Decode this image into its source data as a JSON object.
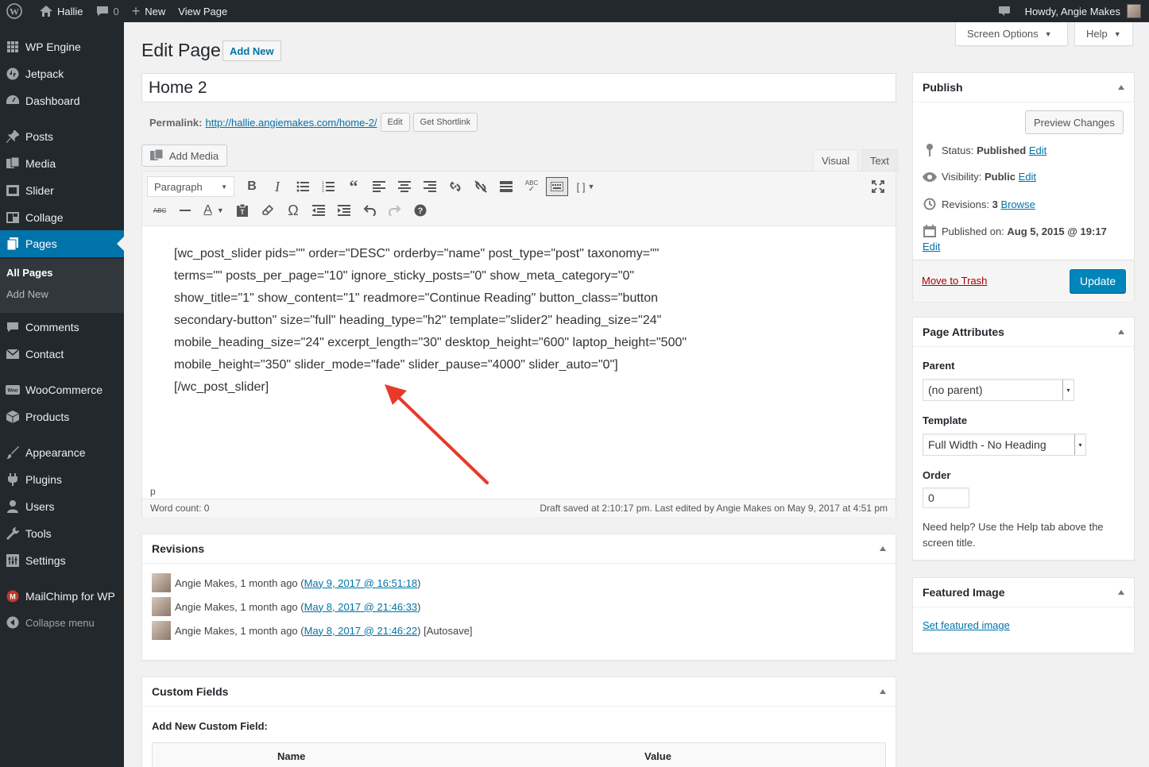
{
  "adminbar": {
    "site_name": "Hallie",
    "comments_count": "0",
    "new_label": "New",
    "view_page_label": "View Page",
    "howdy": "Howdy, Angie Makes"
  },
  "sidebar": {
    "items": [
      {
        "label": "WP Engine",
        "icon": "grid-icon"
      },
      {
        "label": "Jetpack",
        "icon": "jetpack-icon"
      },
      {
        "label": "Dashboard",
        "icon": "dashboard-icon"
      },
      {
        "label": "Posts",
        "icon": "pin-icon"
      },
      {
        "label": "Media",
        "icon": "media-icon"
      },
      {
        "label": "Slider",
        "icon": "slider-icon"
      },
      {
        "label": "Collage",
        "icon": "collage-icon"
      },
      {
        "label": "Pages",
        "icon": "pages-icon"
      },
      {
        "label": "Comments",
        "icon": "comment-icon"
      },
      {
        "label": "Contact",
        "icon": "mail-icon"
      },
      {
        "label": "WooCommerce",
        "icon": "woo-icon"
      },
      {
        "label": "Products",
        "icon": "products-icon"
      },
      {
        "label": "Appearance",
        "icon": "brush-icon"
      },
      {
        "label": "Plugins",
        "icon": "plugin-icon"
      },
      {
        "label": "Users",
        "icon": "user-icon"
      },
      {
        "label": "Tools",
        "icon": "wrench-icon"
      },
      {
        "label": "Settings",
        "icon": "settings-icon"
      },
      {
        "label": "MailChimp for WP",
        "icon": "mailchimp-icon"
      },
      {
        "label": "Collapse menu",
        "icon": "collapse-icon"
      }
    ],
    "submenu": [
      "All Pages",
      "Add New"
    ]
  },
  "header": {
    "title": "Edit Page",
    "add_new": "Add New",
    "screen_options": "Screen Options",
    "help": "Help"
  },
  "post": {
    "title": "Home 2",
    "permalink_label": "Permalink:",
    "permalink_url": "http://hallie.angiemakes.com/home-2/",
    "edit_btn": "Edit",
    "shortlink_btn": "Get Shortlink"
  },
  "editor": {
    "add_media": "Add Media",
    "tab_visual": "Visual",
    "tab_text": "Text",
    "format_select": "Paragraph",
    "content": "[wc_post_slider pids=\"\" order=\"DESC\" orderby=\"name\" post_type=\"post\" taxonomy=\"\" terms=\"\" posts_per_page=\"10\" ignore_sticky_posts=\"0\" show_meta_category=\"0\" show_title=\"1\" show_content=\"1\" readmore=\"Continue Reading\" button_class=\"button secondary-button\" size=\"full\" heading_type=\"h2\" template=\"slider2\" heading_size=\"24\" mobile_heading_size=\"24\" excerpt_length=\"30\" desktop_height=\"600\" laptop_height=\"500\" mobile_height=\"350\" slider_mode=\"fade\" slider_pause=\"4000\" slider_auto=\"0\"][/wc_post_slider]",
    "path": "p",
    "word_count": "Word count: 0",
    "draft_saved": "Draft saved at 2:10:17 pm. Last edited by Angie Makes on May 9, 2017 at 4:51 pm"
  },
  "revisions": {
    "title": "Revisions",
    "rows": [
      {
        "prefix": "Angie Makes, 1 month ago (",
        "link": "May 9, 2017 @ 16:51:18",
        "suffix": ")"
      },
      {
        "prefix": "Angie Makes, 1 month ago (",
        "link": "May 8, 2017 @ 21:46:33",
        "suffix": ")"
      },
      {
        "prefix": "Angie Makes, 1 month ago (",
        "link": "May 8, 2017 @ 21:46:22",
        "suffix": ") [Autosave]"
      }
    ]
  },
  "custom_fields": {
    "title": "Custom Fields",
    "add_new_label": "Add New Custom Field:",
    "col_name": "Name",
    "col_value": "Value"
  },
  "publish": {
    "title": "Publish",
    "preview_btn": "Preview Changes",
    "status_label": "Status:",
    "status_value": "Published",
    "visibility_label": "Visibility:",
    "visibility_value": "Public",
    "revisions_label": "Revisions:",
    "revisions_value": "3",
    "browse": "Browse",
    "published_on_label": "Published on:",
    "published_on_value": "Aug 5, 2015 @ 19:17",
    "edit": "Edit",
    "trash": "Move to Trash",
    "update": "Update"
  },
  "page_attributes": {
    "title": "Page Attributes",
    "parent_label": "Parent",
    "parent_value": "(no parent)",
    "template_label": "Template",
    "template_value": "Full Width - No Heading",
    "order_label": "Order",
    "order_value": "0",
    "help_text": "Need help? Use the Help tab above the screen title."
  },
  "featured_image": {
    "title": "Featured Image",
    "link": "Set featured image"
  },
  "colors": {
    "accent": "#0073aa",
    "admin_dark": "#23282d",
    "trash": "#a00",
    "arrow": "#e8392a"
  }
}
